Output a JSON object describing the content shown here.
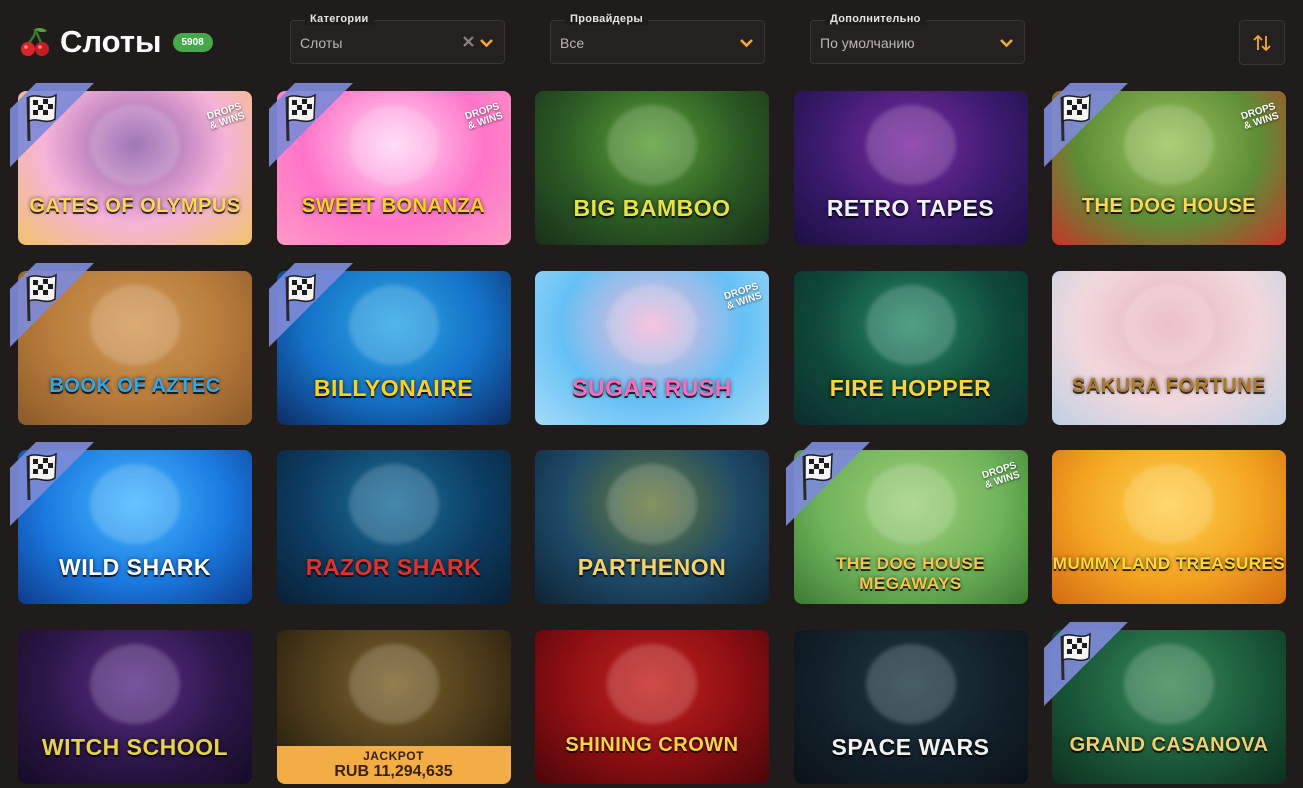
{
  "header": {
    "title": "Слоты",
    "count_badge": "5908",
    "icon": "cherry-icon"
  },
  "filters": {
    "category": {
      "label": "Категории",
      "value": "Слоты"
    },
    "provider": {
      "label": "Провайдеры",
      "value": "Все"
    },
    "sort": {
      "label": "Дополнительно",
      "value": "По умолчанию"
    },
    "sort_toggle_icon": "sort-arrows-icon"
  },
  "games": [
    {
      "title": "GATES of OLYMPUS",
      "flag": true,
      "drops": true,
      "colors": [
        "#f6b3d9",
        "#8a5aa8",
        "#f0c26a"
      ],
      "label_color": "#ffd55a"
    },
    {
      "title": "SWEET BONANZA",
      "flag": true,
      "drops": true,
      "colors": [
        "#ff74c8",
        "#ffd8f5",
        "#ff9ac5"
      ],
      "label_color": "#ffcf27"
    },
    {
      "title": "BIG BAMBOO",
      "flag": false,
      "drops": false,
      "colors": [
        "#2b5a24",
        "#5aa037",
        "#182f19"
      ],
      "label_color": "#e6e34a"
    },
    {
      "title": "RETRO TAPES",
      "flag": false,
      "drops": false,
      "colors": [
        "#3a1b6e",
        "#7d2aa2",
        "#1b1040"
      ],
      "label_color": "#f2f2ff"
    },
    {
      "title": "THE DOG HOUSE",
      "flag": true,
      "drops": true,
      "colors": [
        "#5e8d36",
        "#9bc45a",
        "#c23828"
      ],
      "label_color": "#ffd85a"
    },
    {
      "title": "BOOK OF AZTEC",
      "flag": true,
      "drops": false,
      "colors": [
        "#b77a3b",
        "#d29a56",
        "#8a5a28"
      ],
      "label_color": "#2fa8ee"
    },
    {
      "title": "BILLYONAIRE",
      "flag": true,
      "drops": false,
      "colors": [
        "#1470c6",
        "#2aa7e6",
        "#0d2b63"
      ],
      "label_color": "#ffd11f"
    },
    {
      "title": "Sugar Rush",
      "flag": false,
      "drops": true,
      "colors": [
        "#66c0f5",
        "#f6b9d8",
        "#a3dcf9"
      ],
      "label_color": "#ff6bbd"
    },
    {
      "title": "FIRE HOPPER",
      "flag": false,
      "drops": false,
      "colors": [
        "#0f4a3c",
        "#2a8c6a",
        "#0b2d2a"
      ],
      "label_color": "#ffd43a"
    },
    {
      "title": "SAKURA FORTUNE",
      "flag": false,
      "drops": false,
      "colors": [
        "#f1d8dc",
        "#e7b4bd",
        "#bfd1e4"
      ],
      "label_color": "#b07a2a"
    },
    {
      "title": "WILD SHARK",
      "flag": true,
      "drops": false,
      "colors": [
        "#1a7ae0",
        "#45b8ff",
        "#0d3a8c"
      ],
      "label_color": "#ffffff"
    },
    {
      "title": "RAZOR SHARK",
      "flag": false,
      "drops": false,
      "colors": [
        "#0c3d63",
        "#1c6f9a",
        "#091f35"
      ],
      "label_color": "#e2322b"
    },
    {
      "title": "PARTHENON",
      "flag": false,
      "drops": false,
      "colors": [
        "#1d4a68",
        "#6b7c3a",
        "#0e2333"
      ],
      "label_color": "#f6d26a"
    },
    {
      "title": "THE DOG HOUSE MEGAWAYS",
      "flag": true,
      "drops": true,
      "colors": [
        "#6fb35a",
        "#9fd07a",
        "#3a7a33"
      ],
      "label_color": "#f6c44a"
    },
    {
      "title": "MUMMYLAND TREASURES",
      "flag": false,
      "drops": false,
      "colors": [
        "#f2a321",
        "#ffd24a",
        "#d46a12"
      ],
      "label_color": "#ffda3a"
    },
    {
      "title": "WITCH SCHOOL",
      "flag": false,
      "drops": false,
      "colors": [
        "#2b1748",
        "#5b2f8a",
        "#150b26"
      ],
      "label_color": "#e6d34a"
    },
    {
      "title": "",
      "flag": false,
      "drops": false,
      "colors": [
        "#4a3a1a",
        "#7a6228",
        "#1e1608"
      ],
      "label_color": "#ffffff",
      "jackpot": {
        "label": "JACKPOT",
        "amount": "RUB 11,294,635"
      }
    },
    {
      "title": "SHINING CROWN",
      "flag": false,
      "drops": false,
      "colors": [
        "#8b0e12",
        "#c6231d",
        "#4a0609"
      ],
      "label_color": "#ffd24a"
    },
    {
      "title": "SPACE WARS",
      "flag": false,
      "drops": false,
      "colors": [
        "#12202a",
        "#1f3a44",
        "#0a1216"
      ],
      "label_color": "#f2f2f2"
    },
    {
      "title": "Grand Casanova",
      "flag": true,
      "drops": false,
      "colors": [
        "#1a5a3a",
        "#3a8a56",
        "#0e2f1e"
      ],
      "label_color": "#f0d070"
    }
  ],
  "drops_text": [
    "DROPS",
    "& WINS"
  ]
}
